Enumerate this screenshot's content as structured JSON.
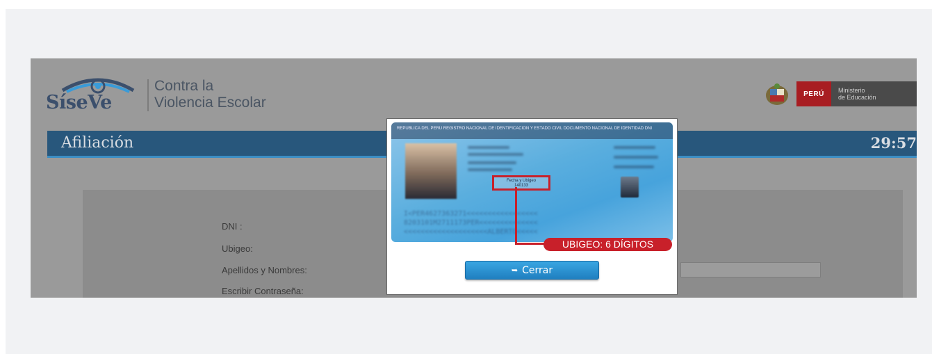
{
  "header": {
    "logo_word_a": "Síse",
    "logo_word_b": "Ve",
    "tagline_line1": "Contra la",
    "tagline_line2": "Violencia Escolar",
    "peru_label": "PERÚ",
    "ministry_line1": "Ministerio",
    "ministry_line2": "de Educación"
  },
  "titlebar": {
    "title": "Afiliación",
    "timer": "29:57"
  },
  "form": {
    "labels": [
      "DNI :",
      "Ubigeo:",
      "Apellidos y Nombres:",
      "Escribir Contraseña:"
    ]
  },
  "modal": {
    "card_header": "REPUBLICA DEL PERU  REGISTRO NACIONAL DE IDENTIFICACION Y ESTADO CIVIL  DOCUMENTO NACIONAL DE IDENTIDAD   DNI",
    "highlight_text_1": "Fecha y Ubigeo",
    "highlight_text_2": "140133",
    "ubigeo_callout": "UBIGEO: 6 DÍGITOS",
    "mrz_line1": "I<PER4627363271<<<<<<<<<<<<<<<<<",
    "mrz_line2": "8203101M2711173PER<<<<<<<<<<<<<<",
    "mrz_line3": "<<<<<<<<<<<<<<<<<<<<ALBERTO<<<<<",
    "close_label": "Cerrar",
    "close_icon": "sign-out-icon"
  },
  "colors": {
    "titlebar": "#28577c",
    "accent_blue": "#1f7fc0",
    "peru_red": "#a81d22",
    "callout_red": "#c8202a"
  }
}
